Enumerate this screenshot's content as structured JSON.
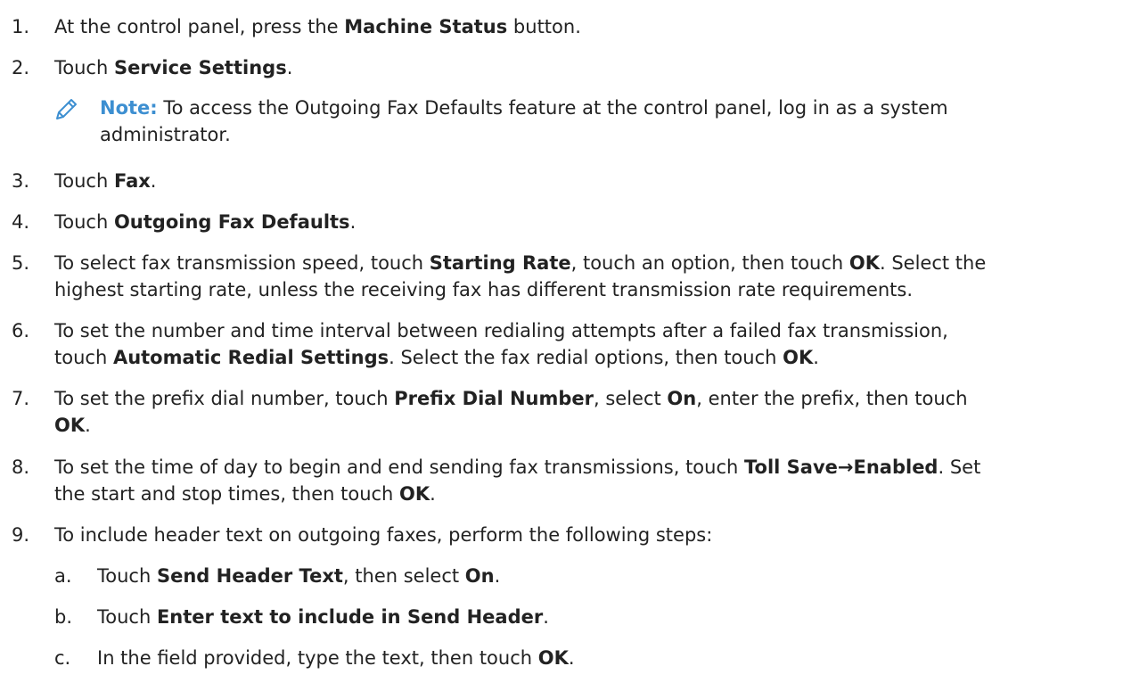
{
  "steps": [
    {
      "num": "1.",
      "parts": [
        "At the control panel, press the ",
        "Machine Status",
        " button."
      ]
    },
    {
      "num": "2.",
      "parts": [
        "Touch ",
        "Service Settings",
        "."
      ]
    },
    {
      "num": "3.",
      "parts": [
        "Touch ",
        "Fax",
        "."
      ]
    },
    {
      "num": "4.",
      "parts": [
        "Touch ",
        "Outgoing Fax Defaults",
        "."
      ]
    },
    {
      "num": "5.",
      "lines": [
        [
          "To select fax transmission speed, touch ",
          "Starting Rate",
          ", touch an option, then touch ",
          "OK",
          ". Select the"
        ],
        [
          "highest starting rate, unless the receiving fax has different transmission rate requirements."
        ]
      ]
    },
    {
      "num": "6.",
      "lines": [
        [
          "To set the number and time interval between redialing attempts after a failed fax transmission,"
        ],
        [
          "touch ",
          "Automatic Redial Settings",
          ". Select the fax redial options, then touch ",
          "OK",
          "."
        ]
      ]
    },
    {
      "num": "7.",
      "lines": [
        [
          "To set the prefix dial number, touch ",
          "Prefix Dial Number",
          ", select ",
          "On",
          ", enter the prefix, then touch"
        ],
        [
          "",
          "OK",
          "."
        ]
      ]
    },
    {
      "num": "8.",
      "lines": [
        [
          "To set the time of day to begin and end sending fax transmissions, touch ",
          "Toll Save→Enabled",
          ". Set"
        ],
        [
          "the start and stop times, then touch ",
          "OK",
          "."
        ]
      ]
    },
    {
      "num": "9.",
      "parts": [
        "To include header text on outgoing faxes, perform the following steps:"
      ]
    }
  ],
  "substeps": [
    {
      "num": "a.",
      "parts": [
        "Touch ",
        "Send Header Text",
        ", then select ",
        "On",
        "."
      ]
    },
    {
      "num": "b.",
      "parts": [
        "Touch ",
        "Enter text to include in Send Header",
        "."
      ]
    },
    {
      "num": "c.",
      "parts": [
        "In the field provided, type the text, then touch ",
        "OK",
        "."
      ]
    }
  ],
  "note": {
    "icon": "pencil-icon",
    "label": "Note:",
    "line1": " To access the Outgoing Fax Defaults feature at the control panel, log in as a system",
    "line2": "administrator."
  },
  "colors": {
    "note_label": "#3d8fd1",
    "text": "#222222"
  }
}
